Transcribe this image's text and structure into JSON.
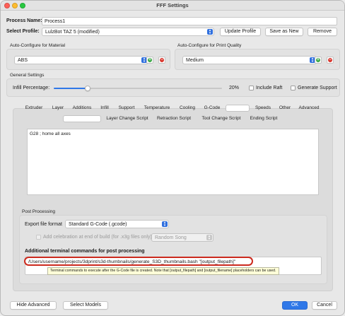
{
  "window": {
    "title": "FFF Settings"
  },
  "process": {
    "name_label": "Process Name:",
    "name_value": "Process1",
    "profile_label": "Select Profile:",
    "profile_value": "LulzBot TAZ 5 (modified)",
    "update_button": "Update Profile",
    "save_as_new_button": "Save as New",
    "remove_button": "Remove"
  },
  "material": {
    "group_label": "Auto-Configure for Material",
    "value": "ABS"
  },
  "quality": {
    "group_label": "Auto-Configure for Print Quality",
    "value": "Medium"
  },
  "general": {
    "group_label": "General Settings",
    "infill_label": "Infill Percentage:",
    "infill_value_text": "20%",
    "infill_value": 0.2,
    "include_raft_label": "Include Raft",
    "generate_support_label": "Generate Support"
  },
  "tabs": [
    {
      "label": "Extruder"
    },
    {
      "label": "Layer"
    },
    {
      "label": "Additions"
    },
    {
      "label": "Infill"
    },
    {
      "label": "Support"
    },
    {
      "label": "Temperature"
    },
    {
      "label": "Cooling"
    },
    {
      "label": "G-Code"
    },
    {
      "label": ""
    },
    {
      "label": "Speeds"
    },
    {
      "label": "Other"
    },
    {
      "label": "Advanced"
    }
  ],
  "subtabs": [
    {
      "label": ""
    },
    {
      "label": "Layer Change Script"
    },
    {
      "label": "Retraction Script"
    },
    {
      "label": "Tool Change Script"
    },
    {
      "label": "Ending Script"
    }
  ],
  "script_text": "G28 ; home all axes",
  "post_processing": {
    "group_label": "Post Processing",
    "export_format_label": "Export file format",
    "export_format_value": "Standard G-Code (.gcode)",
    "celebration_label": "Add celebration at end of build (for .x3g files only)",
    "celebration_value": "Random Song",
    "additional_commands_label": "Additional terminal commands for post processing",
    "additional_commands_value": "/Users/username/projects/3dprint/s3d-thumbnails/generate_S3D_thumbnails.bash  \"[output_filepath]\"",
    "tooltip": "Terminal commands to execute after the G-Code file is created.  Note that [output_filepath] and [output_filename] placeholders can be used."
  },
  "footer": {
    "hide_advanced_button": "Hide Advanced",
    "select_models_button": "Select Models",
    "ok_button": "OK",
    "cancel_button": "Cancel"
  },
  "colors": {
    "accent": "#2f78e8",
    "highlight": "#cc2a1e",
    "add_green": "#3aa845",
    "remove_red": "#d9342b"
  }
}
